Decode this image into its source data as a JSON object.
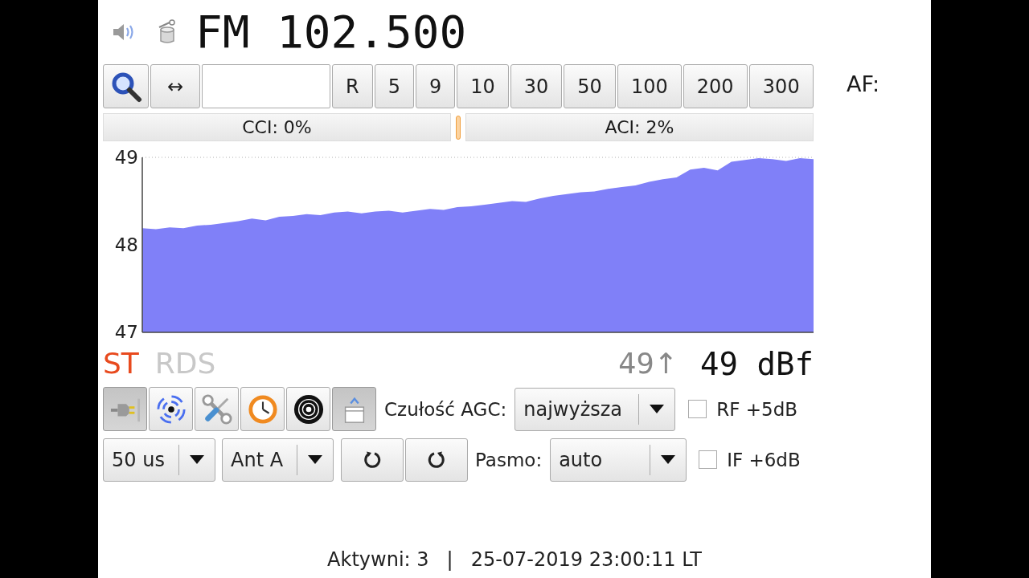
{
  "header": {
    "frequency": "FM 102.500"
  },
  "toolbar": {
    "arrow_button": "↔",
    "step_buttons": [
      "R",
      "5",
      "9",
      "10",
      "30",
      "50",
      "100",
      "200",
      "300"
    ],
    "af_label": "AF:"
  },
  "interference": {
    "cci": "CCI: 0%",
    "aci": "ACI: 2%"
  },
  "signal_chart": {
    "chart_data": [
      {
        "type": "area",
        "color": "#8080f8",
        "ylim": [
          47,
          49
        ],
        "yticks": [
          47,
          48,
          49
        ],
        "tick_labels": "y",
        "ref_lines": [
          {
            "axis": "y",
            "value": 49,
            "color": "#b0b0b0",
            "line_style": "dotted"
          }
        ],
        "values": [
          48.19,
          48.18,
          48.2,
          48.19,
          48.22,
          48.23,
          48.25,
          48.27,
          48.3,
          48.28,
          48.32,
          48.33,
          48.35,
          48.34,
          48.37,
          48.38,
          48.36,
          48.38,
          48.39,
          48.37,
          48.39,
          48.41,
          48.4,
          48.43,
          48.44,
          48.46,
          48.48,
          48.5,
          48.49,
          48.53,
          48.56,
          48.58,
          48.6,
          48.61,
          48.64,
          48.66,
          48.68,
          48.72,
          48.75,
          48.77,
          48.86,
          48.88,
          48.85,
          48.95,
          48.97,
          48.99,
          48.98,
          48.96,
          48.99,
          48.98
        ]
      }
    ]
  },
  "indicators": [
    {
      "label": "ST",
      "on": true
    },
    {
      "label": "RDS",
      "on": false
    }
  ],
  "signal": {
    "peak": "49↑",
    "value": "49 dBf"
  },
  "tool_buttons": [
    {
      "kind": "plug",
      "on": true
    },
    {
      "kind": "broadcast",
      "on": false
    },
    {
      "kind": "tools",
      "on": false
    },
    {
      "kind": "clock",
      "on": false
    },
    {
      "kind": "disc",
      "on": false
    },
    {
      "kind": "window",
      "on": true
    }
  ],
  "agc": {
    "label": "Czułość AGC:",
    "value": "najwyższa"
  },
  "rf_boost": {
    "label": "RF +5dB",
    "checked": false
  },
  "deemphasis": {
    "value": "50 us"
  },
  "antenna": {
    "value": "Ant A"
  },
  "rotator_buttons": [
    {
      "kind": "ccw"
    },
    {
      "kind": "cw"
    }
  ],
  "bandwidth": {
    "label": "Pasmo:",
    "value": "auto"
  },
  "if_boost": {
    "label": "IF +6dB",
    "checked": false
  },
  "footer": {
    "users": "Aktywni: 3",
    "separator": "|",
    "time": "25-07-2019 23:00:11 LT"
  }
}
